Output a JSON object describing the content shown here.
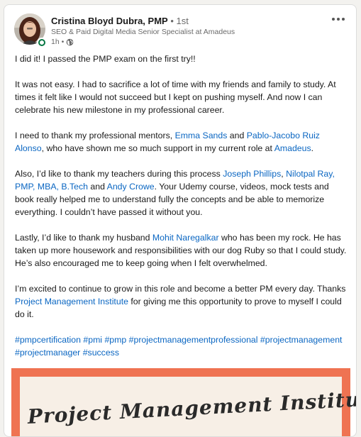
{
  "author": {
    "name": "Cristina Bloyd Dubra, PMP",
    "separator": "•",
    "degree": "1st",
    "headline": "SEO & Paid Digital Media Senior Specialist at Amadeus",
    "time": "1h •"
  },
  "post": {
    "p1": "I did it! I passed the PMP exam on the first try!!",
    "p2": "It was not easy. I had to sacrifice a lot of time with my friends and family to study. At times it felt like I would not succeed but I kept on pushing myself. And now I can celebrate his new milestone in my professional career.",
    "p3_a": "I need to thank my professional mentors, ",
    "p3_mention1": "Emma Sands",
    "p3_b": " and ",
    "p3_mention2": "Pablo-Jacobo Ruiz Alonso",
    "p3_c": ", who have shown me so much support in my current role at ",
    "p3_mention3": "Amadeus",
    "p3_d": ".",
    "p4_a": "Also, I’d like to thank my teachers during this process ",
    "p4_mention1": "Joseph Phillips",
    "p4_b": ", ",
    "p4_mention2": "Nilotpal Ray, PMP, MBA, B.Tech",
    "p4_c": " and ",
    "p4_mention3": "Andy Crowe",
    "p4_d": ". Your Udemy course, videos, mock tests and book really helped me to understand fully the concepts and be able to memorize everything. I couldn’t have passed it without you.",
    "p5_a": "Lastly, I’d like to thank my husband ",
    "p5_mention1": "Mohit Naregalkar",
    "p5_b": " who has been my rock. He has taken up more housework and responsibilities with our dog Ruby so that I could study. He’s also encouraged me to keep going when I felt overwhelmed.",
    "p6_a": "I’m excited to continue to grow in this role and become a better PM every day. Thanks ",
    "p6_mention1": "Project Management Institute",
    "p6_b": " for giving me this opportunity to prove to myself I could do it.",
    "hashtags": [
      "#pmpcertification",
      "#pmi",
      "#pmp",
      "#projectmanagementprofessional",
      "#projectmanagement",
      "#projectmanager",
      "#success"
    ]
  },
  "image": {
    "certificate_text": "Project Management Institute"
  },
  "colors": {
    "link": "#0a66c2",
    "certificate_border": "#ef7352",
    "online_indicator": "#057642"
  },
  "icons": {
    "more": "ellipsis-icon",
    "visibility": "globe-icon"
  }
}
